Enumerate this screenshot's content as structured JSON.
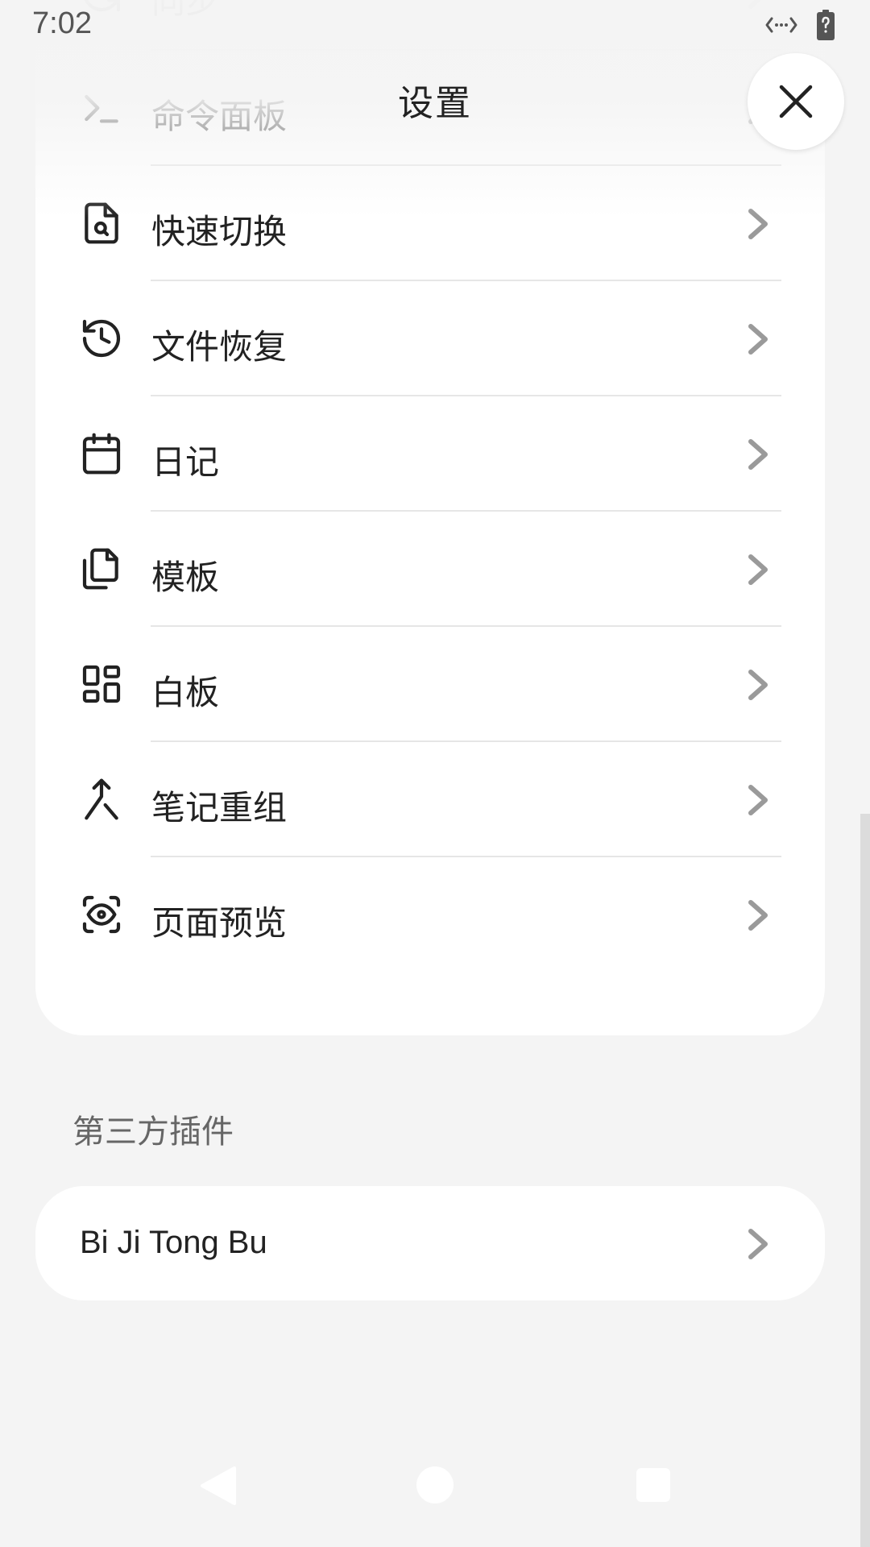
{
  "status_bar": {
    "time": "7:02"
  },
  "header": {
    "title": "设置"
  },
  "core_plugins": [
    {
      "label": "同步",
      "icon": "sync-icon"
    },
    {
      "label": "命令面板",
      "icon": "terminal-icon"
    },
    {
      "label": "快速切换",
      "icon": "file-search-icon"
    },
    {
      "label": "文件恢复",
      "icon": "history-icon"
    },
    {
      "label": "日记",
      "icon": "calendar-icon"
    },
    {
      "label": "模板",
      "icon": "files-icon"
    },
    {
      "label": "白板",
      "icon": "layout-dashboard-icon"
    },
    {
      "label": "笔记重组",
      "icon": "merge-icon"
    },
    {
      "label": "页面预览",
      "icon": "scan-eye-icon"
    }
  ],
  "third_party": {
    "section_title": "第三方插件",
    "items": [
      {
        "label": "Bi Ji Tong Bu"
      }
    ]
  },
  "colors": {
    "background": "#f4f4f4",
    "card": "#ffffff",
    "text": "#222222",
    "chevron": "#9a9a9a"
  }
}
